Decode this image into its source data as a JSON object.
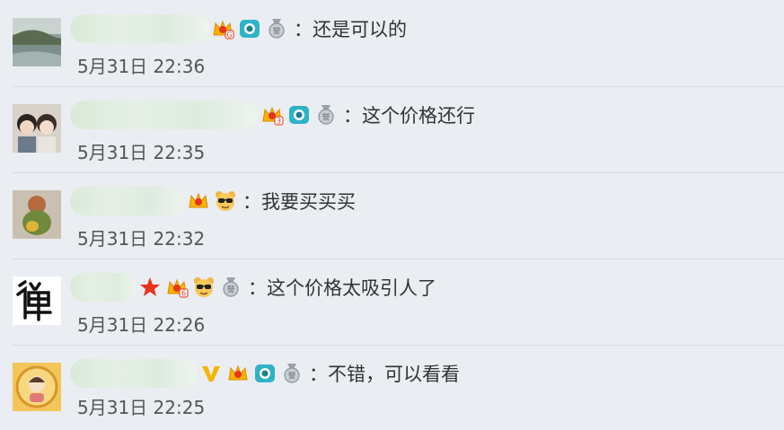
{
  "comments": [
    {
      "text": "：还是可以的",
      "time": "5月31日 22:36"
    },
    {
      "text": "：这个价格还行",
      "time": "5月31日 22:35"
    },
    {
      "text": "：我要买买买",
      "time": "5月31日 22:32"
    },
    {
      "text": "：这个价格太吸引人了",
      "time": "5月31日 22:26"
    },
    {
      "text": "：不错，可以看看",
      "time": "5月31日 22:25"
    }
  ],
  "badges": {
    "crown_level_1": "G",
    "crown_level_2": "3",
    "crown_level_4": "6",
    "medal_glyph": "誉"
  },
  "icons": [
    "crown-icon",
    "camera-icon",
    "medal-icon",
    "cool-bear-icon",
    "red-star-icon",
    "v-verified-icon"
  ],
  "colors": {
    "background": "#eaedf1",
    "separator": "#d6d9de",
    "crown": "#f5b400",
    "camera": "#2fb3c8",
    "star": "#e8341c",
    "vip": "#f5b400"
  }
}
